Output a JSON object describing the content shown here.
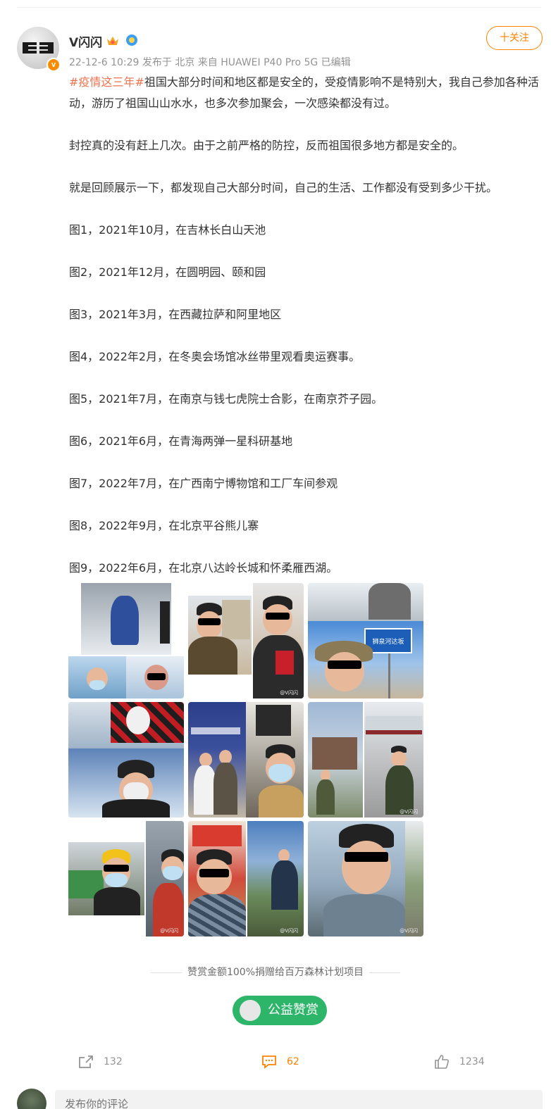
{
  "author": {
    "name": "V闪闪",
    "avatar_text": "ヨヨ",
    "badge_text": "v"
  },
  "meta": {
    "text": "22-12-6 10:29 发布于 北京 来自 HUAWEI P40 Pro 5G 已编辑"
  },
  "follow_label": "十关注",
  "post": {
    "hashtag": "#疫情这三年#",
    "first_paragraph_rest": "祖国大部分时间和地区都是安全的，受疫情影响不是特别大，我自己参加各种活动，游历了祖国山山水水，也多次参加聚会，一次感染都没有过。",
    "paragraphs": [
      "封控真的没有赶上几次。由于之前严格的防控，反而祖国很多地方都是安全的。",
      "就是回顾展示一下，都发现自己大部分时间，自己的生活、工作都没有受到多少干扰。",
      "图1，2021年10月，在吉林长白山天池",
      "图2，2021年12月，在圆明园、颐和园",
      "图3，2021年3月，在西藏拉萨和阿里地区",
      "图4，2022年2月，在冬奥会场馆冰丝带里观看奥运赛事。",
      "图5，2021年7月，在南京与钱七虎院士合影，在南京芥子园。",
      "图6，2021年6月，在青海两弹一星科研基地",
      "图7，2022年7月，在广西南宁博物馆和工厂车间参观",
      "图8，2022年9月，在北京平谷熊儿寨",
      "图9，2022年6月，在北京八达岭长城和怀柔雁西湖。"
    ]
  },
  "gallery": {
    "sign_text": "狮泉河达坂",
    "watermark": "@V闪闪"
  },
  "donate": {
    "note": "赞赏金额100%捐赠给百万森林计划项目",
    "button_label": "公益赞赏"
  },
  "actions": {
    "repost_count": "132",
    "comment_count": "62",
    "like_count": "1234"
  },
  "comment_box": {
    "placeholder": "发布你的评论"
  },
  "colors": {
    "accent": "#ff8200",
    "hashtag": "#eb7350",
    "donate": "#2db56a"
  }
}
